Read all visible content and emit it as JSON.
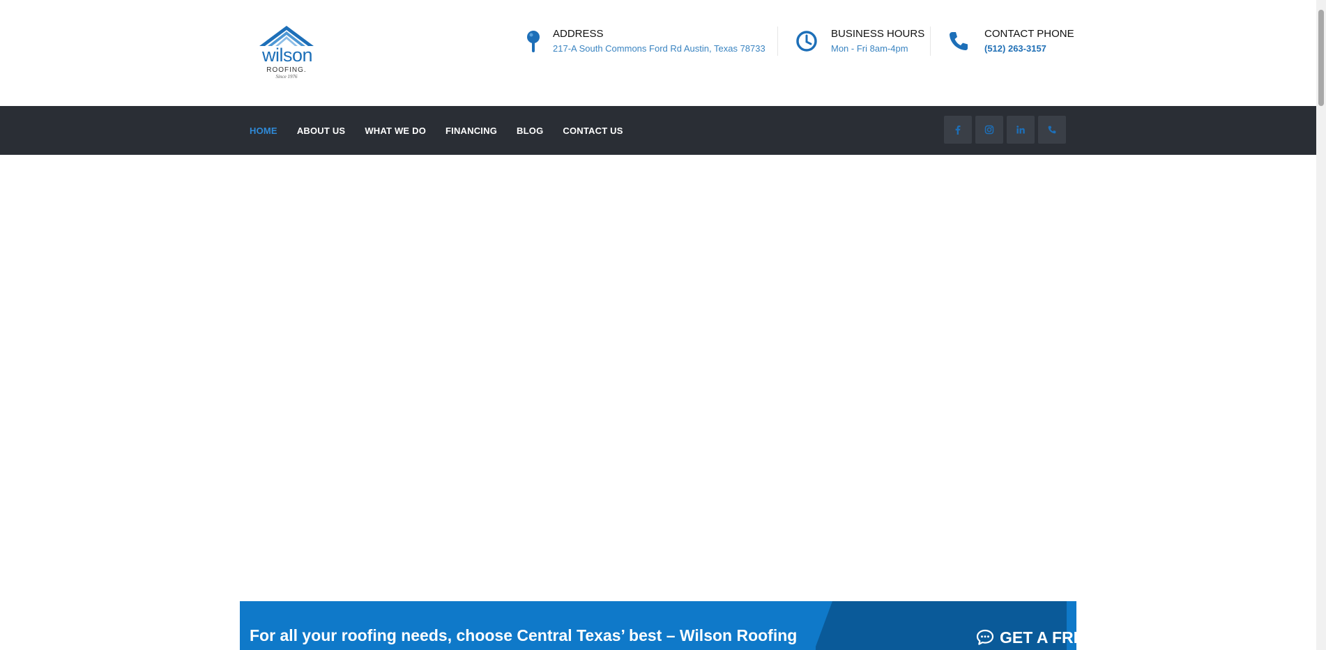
{
  "logo": {
    "word": "wilson",
    "sub": "ROOFING.",
    "since": "Since 1976"
  },
  "header": {
    "address": {
      "title": "ADDRESS",
      "value": "217-A South Commons Ford Rd Austin, Texas 78733",
      "icon": "map-pin-icon"
    },
    "hours": {
      "title": "BUSINESS HOURS",
      "value": "Mon - Fri 8am-4pm",
      "icon": "clock-icon"
    },
    "phone": {
      "title": "CONTACT PHONE",
      "value": "(512) 263-3157",
      "icon": "phone-icon"
    }
  },
  "nav": {
    "items": [
      {
        "label": "HOME",
        "active": true
      },
      {
        "label": "ABOUT US"
      },
      {
        "label": "WHAT WE DO"
      },
      {
        "label": "FINANCING"
      },
      {
        "label": "BLOG"
      },
      {
        "label": "CONTACT US"
      }
    ],
    "social": [
      "facebook-icon",
      "instagram-icon",
      "linkedin-icon",
      "phone-icon"
    ]
  },
  "cta": {
    "message": "For all your roofing needs, choose Central Texas’ best – Wilson Roofing",
    "button_label": "GET A FREE QUOTE",
    "button_icon": "chat-bubble-icon"
  },
  "colors": {
    "brand_blue": "#1d6fb8",
    "nav_bg": "#2a2e35",
    "nav_active": "#2f8ad8",
    "cta_bg": "#0f79c9",
    "cta_dark": "#0a5a99"
  }
}
